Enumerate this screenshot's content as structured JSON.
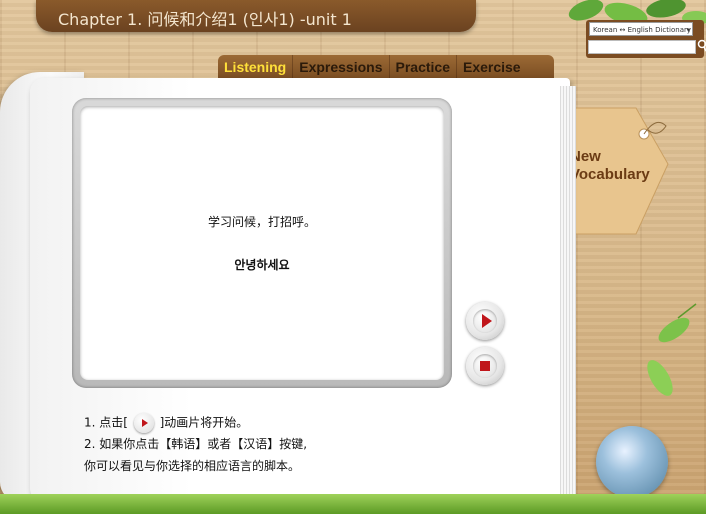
{
  "header": {
    "title": "Chapter 1. 问候和介绍1 (인사1) -unit 1"
  },
  "dictionary": {
    "selected": "Korean ↔ English Dictionary",
    "input_placeholder": ""
  },
  "tabs": [
    {
      "label": "Listening",
      "active": true
    },
    {
      "label": "Expressions",
      "active": false
    },
    {
      "label": "Practice",
      "active": false
    },
    {
      "label": "Exercise",
      "active": false
    }
  ],
  "screen": {
    "line1": "学习问候，打招呼。",
    "line2": "안녕하세요"
  },
  "vocab_tag": {
    "line1": "New",
    "line2": "Vocabulary"
  },
  "instructions": {
    "step1_prefix": "1.  点击[",
    "step1_suffix": "]动画片将开始。",
    "step2": "2.  如果你点击【韩语】或者【汉语】按键,",
    "step2b": "你可以看见与你选择的相应语言的脚本。"
  },
  "colors": {
    "active_tab": "#ffe03a",
    "play_red": "#c0161b",
    "wood": "#d9b98a"
  }
}
